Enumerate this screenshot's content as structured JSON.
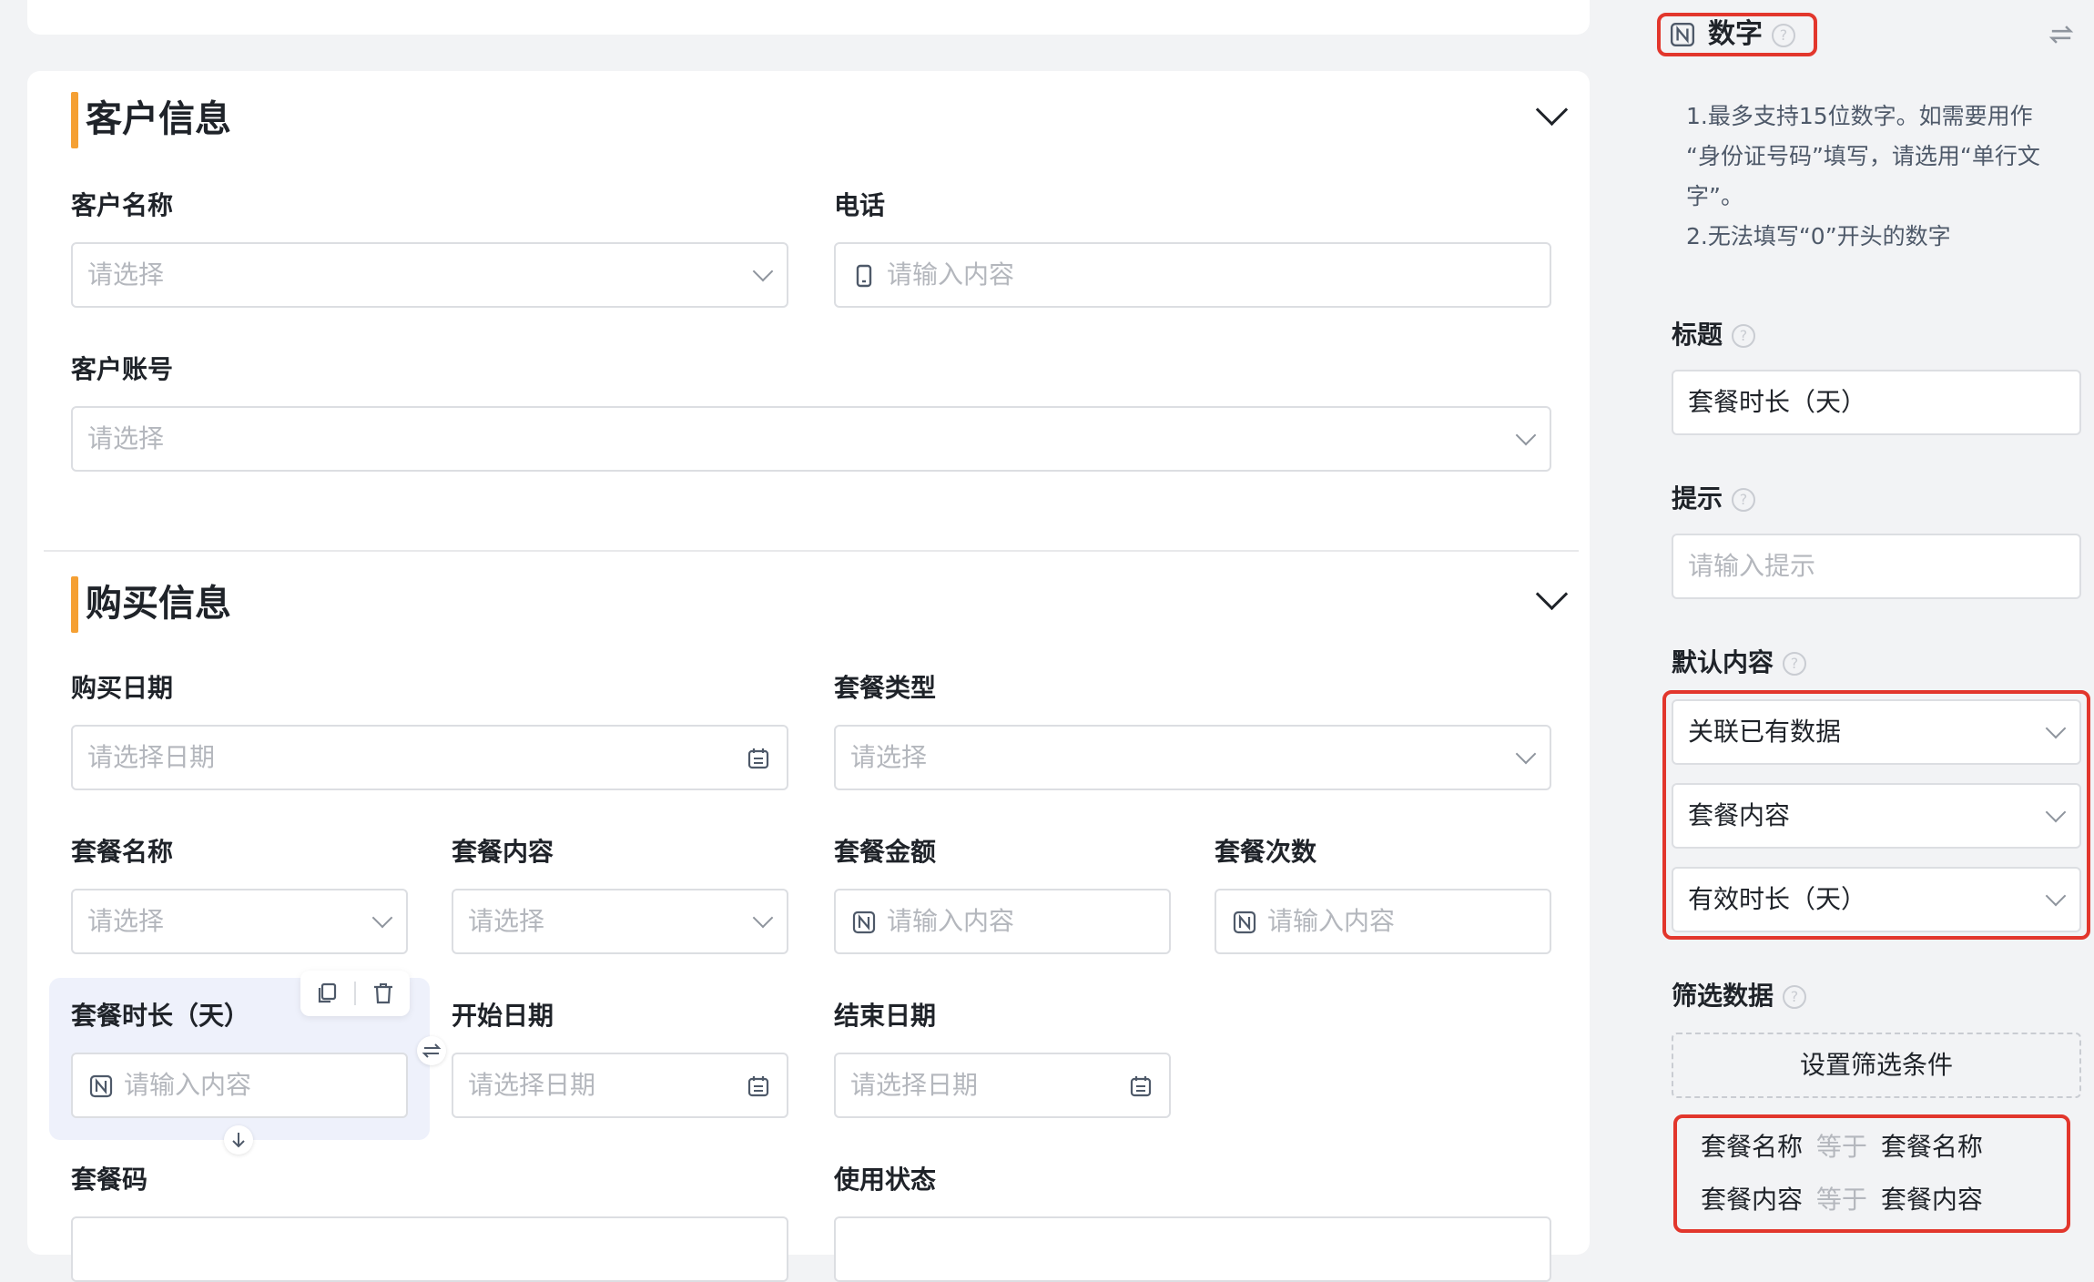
{
  "customer_section": {
    "title": "客户信息",
    "customer_name": {
      "label": "客户名称",
      "placeholder": "请选择"
    },
    "phone": {
      "label": "电话",
      "placeholder": "请输入内容"
    },
    "customer_account": {
      "label": "客户账号",
      "placeholder": "请选择"
    }
  },
  "purchase_section": {
    "title": "购买信息",
    "purchase_date": {
      "label": "购买日期",
      "placeholder": "请选择日期"
    },
    "package_type": {
      "label": "套餐类型",
      "placeholder": "请选择"
    },
    "package_name": {
      "label": "套餐名称",
      "placeholder": "请选择"
    },
    "package_content": {
      "label": "套餐内容",
      "placeholder": "请选择"
    },
    "package_amount": {
      "label": "套餐金额",
      "placeholder": "请输入内容"
    },
    "package_count": {
      "label": "套餐次数",
      "placeholder": "请输入内容"
    },
    "package_duration": {
      "label": "套餐时长（天）",
      "placeholder": "请输入内容"
    },
    "start_date": {
      "label": "开始日期",
      "placeholder": "请选择日期"
    },
    "end_date": {
      "label": "结束日期",
      "placeholder": "请选择日期"
    },
    "package_code": {
      "label": "套餐码"
    },
    "usage_status": {
      "label": "使用状态"
    }
  },
  "panel": {
    "field_type": "数字",
    "tips": [
      "1.最多支持15位数字。如需要用作",
      "“身份证号码”填写，请选用“单行文",
      "字”。",
      "2.无法填写“0”开头的数字"
    ],
    "title_label": "标题",
    "title_value": "套餐时长（天）",
    "hint_label": "提示",
    "hint_placeholder": "请输入提示",
    "default_label": "默认内容",
    "default_source": "关联已有数据",
    "default_form": "套餐内容",
    "default_field": "有效时长（天）",
    "filter_label": "筛选数据",
    "filter_button": "设置筛选条件",
    "filters": [
      {
        "field": "套餐名称",
        "op": "等于",
        "value": "套餐名称"
      },
      {
        "field": "套餐内容",
        "op": "等于",
        "value": "套餐内容"
      }
    ]
  },
  "colors": {
    "accent": "#f5a033",
    "highlight": "#e2362c",
    "selected_bg": "#eef1fb"
  }
}
